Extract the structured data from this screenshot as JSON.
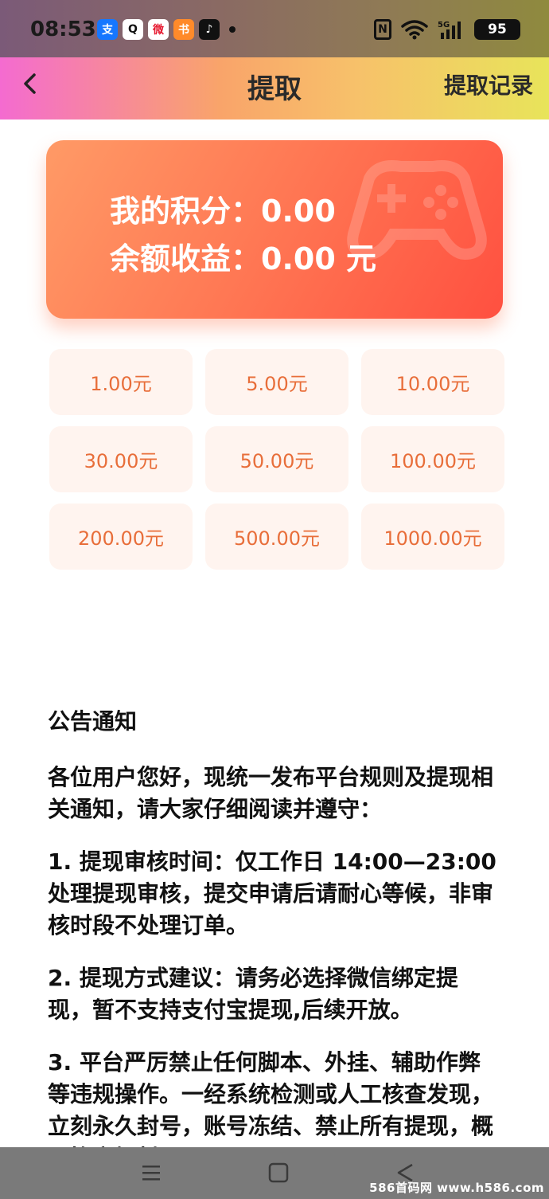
{
  "status_bar": {
    "time": "08:53",
    "battery": "95",
    "apps": [
      {
        "name": "alipay",
        "glyph": "支",
        "color": "#1677ff"
      },
      {
        "name": "qq",
        "glyph": "Q",
        "color": "#111111"
      },
      {
        "name": "weibo",
        "glyph": "微",
        "color": "#e6162d"
      },
      {
        "name": "books",
        "glyph": "书",
        "color": "#ff8a2a"
      },
      {
        "name": "tiktok",
        "glyph": "♪",
        "color": "#111111"
      }
    ]
  },
  "header": {
    "title": "提取",
    "record_link": "提取记录"
  },
  "points_card": {
    "points_line": "我的积分：0.00",
    "balance_line": "余额收益：0.00 元"
  },
  "amount_options": [
    "1.00元",
    "5.00元",
    "10.00元",
    "30.00元",
    "50.00元",
    "100.00元",
    "200.00元",
    "500.00元",
    "1000.00元"
  ],
  "notice": {
    "title": "公告通知",
    "paragraphs": [
      "各位用户您好，现统一发布平台规则及提现相关通知，请大家仔细阅读并遵守：",
      "1. 提现审核时间：仅工作日 14:00—23:00 处理提现审核，提交申请后请耐心等候，非审核时段不处理订单。",
      "2. 提现方式建议：请务必选择微信绑定提现，暂不支持支付宝提现,后续开放。",
      "3. 平台严厉禁止任何脚本、外挂、辅助作弊等违规操作。一经系统检测或人工核查发现，立刻永久封号，账号冻结、禁止所有提现，概不协商解封。"
    ]
  },
  "watermark": "586首码网 www.h586.com",
  "colors": {
    "accent": "#ff6a4a",
    "amount_text": "#e86e3a",
    "amount_bg": "#fff4ef"
  }
}
